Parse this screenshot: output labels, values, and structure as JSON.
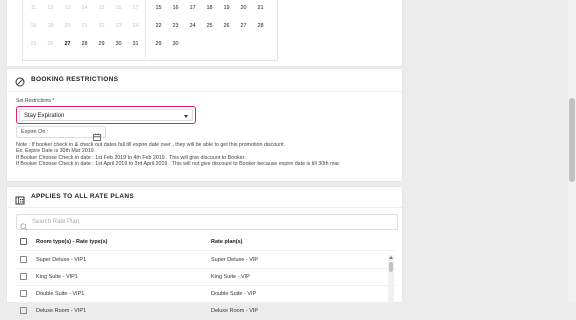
{
  "calendar": {
    "left_month": [
      [
        {
          "d": "11",
          "m": true
        },
        {
          "d": "12",
          "m": true
        },
        {
          "d": "13",
          "m": true
        },
        {
          "d": "14",
          "m": true
        },
        {
          "d": "15",
          "m": true
        },
        {
          "d": "16",
          "m": true
        },
        {
          "d": "17",
          "m": true
        }
      ],
      [
        {
          "d": "18",
          "m": true
        },
        {
          "d": "19",
          "m": true
        },
        {
          "d": "20",
          "m": true
        },
        {
          "d": "21",
          "m": true
        },
        {
          "d": "22",
          "m": true
        },
        {
          "d": "23",
          "m": true
        },
        {
          "d": "24",
          "m": true
        }
      ],
      [
        {
          "d": "25",
          "m": true
        },
        {
          "d": "26",
          "m": true
        },
        {
          "d": "27",
          "b": true
        },
        {
          "d": "28"
        },
        {
          "d": "29"
        },
        {
          "d": "30"
        },
        {
          "d": "31"
        }
      ]
    ],
    "right_month": [
      [
        {
          "d": "15"
        },
        {
          "d": "16"
        },
        {
          "d": "17"
        },
        {
          "d": "18"
        },
        {
          "d": "19"
        },
        {
          "d": "20"
        },
        {
          "d": "21"
        }
      ],
      [
        {
          "d": "22"
        },
        {
          "d": "23"
        },
        {
          "d": "24"
        },
        {
          "d": "25"
        },
        {
          "d": "26"
        },
        {
          "d": "27"
        },
        {
          "d": "28"
        }
      ],
      [
        {
          "d": "29"
        },
        {
          "d": "30"
        }
      ]
    ]
  },
  "booking_restrictions": {
    "title": "BOOKING RESTRICTIONS",
    "set_label": "Set Restrictions *",
    "selected": "Stay Expiration",
    "expire_label": "Expire On :",
    "notes": [
      "Note : If booker check in & check out dates fall till expire date over , they will be able to get this promotion discount.",
      "Ex. Expire Date is 30th Mar 2019.",
      "If Booker Choose Check in date : 1st Feb 2019 to 4th Feb 2019 . This will give discount to Booker.",
      "If Booker Choose Check in date : 1st April 2019 to 3rd April 2019 . This will not give discount to Booker because expire date is till 30th mar."
    ],
    "accent_color": "#e2215d"
  },
  "rate_plans": {
    "title": "APPLIES TO ALL RATE PLANS",
    "search_placeholder": "Search Rate Plan",
    "headers": {
      "room": "Room type(s) - Rate type(s)",
      "plan": "Rate plan(s)"
    },
    "rows": [
      {
        "room": "Super Deluxe - VIP1",
        "plan": "Super Deluxe - VIP"
      },
      {
        "room": "King Suite - VIP1",
        "plan": "King Suite - VIP"
      },
      {
        "room": "Double Suite - VIP1",
        "plan": "Double Suite - VIP"
      },
      {
        "room": "Deluxe Room - VIP1",
        "plan": "Deluxe Room - VIP"
      }
    ]
  }
}
